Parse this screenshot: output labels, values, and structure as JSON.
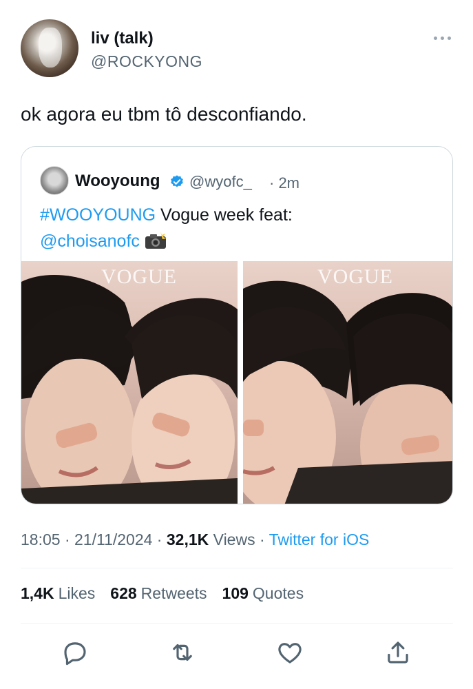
{
  "author": {
    "display_name": "liv (talk)",
    "handle": "@ROCKYONG",
    "avatar_icon": "avatar"
  },
  "tweet": {
    "text": "ok agora eu tbm tô desconfiando."
  },
  "quoted_tweet": {
    "display_name": "Wooyoung",
    "handle": "@wyofc_",
    "time": "· 2m",
    "hashtag": "#WOOYOUNG",
    "text_after_hashtag": " Vogue week feat:",
    "mention": "@choisanofc",
    "emoji_icon": "camera-flash-icon",
    "photos": [
      {
        "watermark": "VOGUE"
      },
      {
        "watermark": "VOGUE"
      }
    ]
  },
  "meta": {
    "time": "18:05",
    "sep1": " · ",
    "date": "21/11/2024",
    "sep2": " · ",
    "views_count": "32,1K",
    "views_label": " Views",
    "sep3": " · ",
    "source": "Twitter for iOS"
  },
  "stats": {
    "likes_count": "1,4K",
    "likes_label": "Likes",
    "retweets_count": "628",
    "retweets_label": "Retweets",
    "quotes_count": "109",
    "quotes_label": "Quotes"
  },
  "colors": {
    "link": "#1d9bf0",
    "secondary_text": "#536471",
    "border": "#cfd9de"
  }
}
